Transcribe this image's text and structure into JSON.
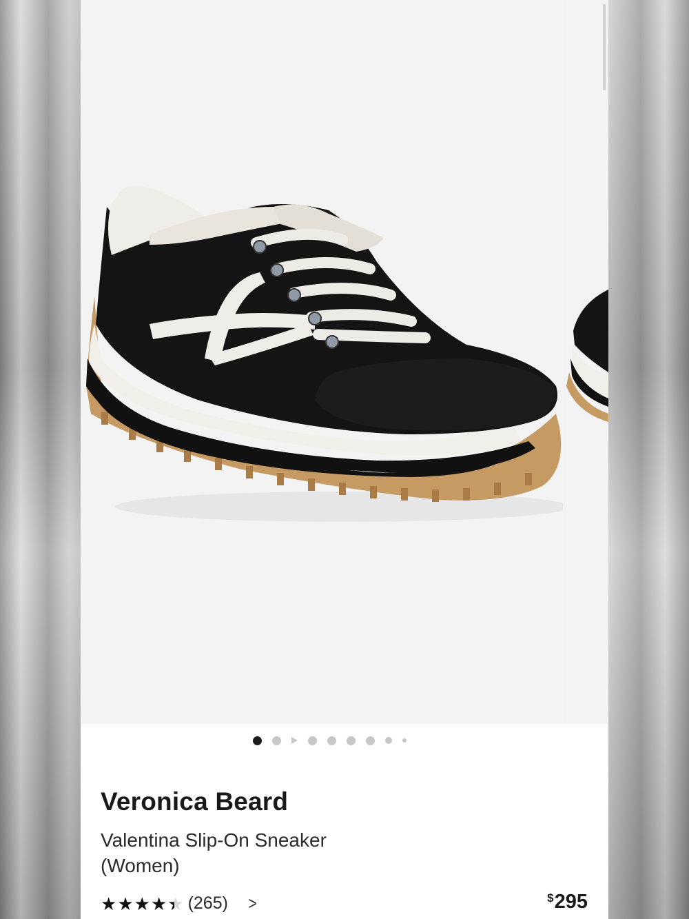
{
  "gallery": {
    "image_count": 9,
    "active_index": 0
  },
  "product": {
    "brand": "Veronica Beard",
    "name": "Valentina Slip-On Sneaker (Women)",
    "rating": 4.3,
    "rating_max": 5,
    "review_count": "(265)",
    "price_currency": "$",
    "price_amount": "295"
  },
  "icons": {
    "rating_chevron": "chevron-right-icon",
    "video_dot": "play-icon"
  },
  "colors": {
    "text": "#191919",
    "dot_active": "#1b1b1b",
    "dot_inactive": "#c7c7c7"
  }
}
